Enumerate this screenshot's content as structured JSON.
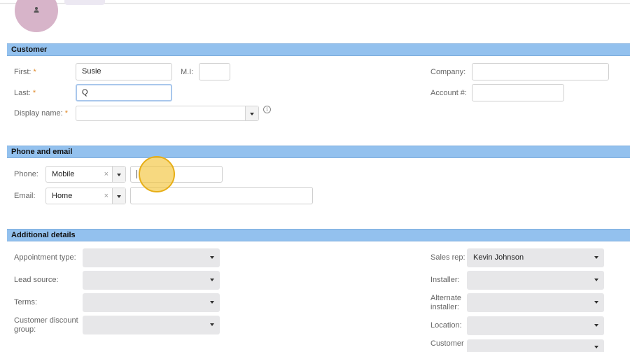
{
  "avatar": {
    "icon": "person-icon"
  },
  "customer": {
    "section_title": "Customer",
    "first_label": "First:",
    "first_value": "Susie",
    "mi_label": "M.I:",
    "mi_value": "",
    "last_label": "Last:",
    "last_value": "Q",
    "display_name_label": "Display name:",
    "display_name_value": "",
    "company_label": "Company:",
    "company_value": "",
    "account_label": "Account #:",
    "account_value": "",
    "required_mark": "*"
  },
  "phone_email": {
    "section_title": "Phone and email",
    "phone_label": "Phone:",
    "phone_type": "Mobile",
    "phone_value": "",
    "email_label": "Email:",
    "email_type": "Home",
    "email_value": "",
    "clear_glyph": "×"
  },
  "additional": {
    "section_title": "Additional details",
    "appointment_type_label": "Appointment type:",
    "lead_source_label": "Lead source:",
    "terms_label": "Terms:",
    "customer_discount_group_label_1": "Customer discount",
    "customer_discount_group_label_2": "group:",
    "sales_rep_label": "Sales rep:",
    "sales_rep_value": "Kevin Johnson",
    "installer_label": "Installer:",
    "alternate_installer_label_1": "Alternate",
    "alternate_installer_label_2": "installer:",
    "location_label": "Location:",
    "customer_partial_label": "Customer"
  },
  "colors": {
    "section_bar": "#93c1ee",
    "required": "#e08a2a",
    "click_marker": "#f2c43c"
  }
}
